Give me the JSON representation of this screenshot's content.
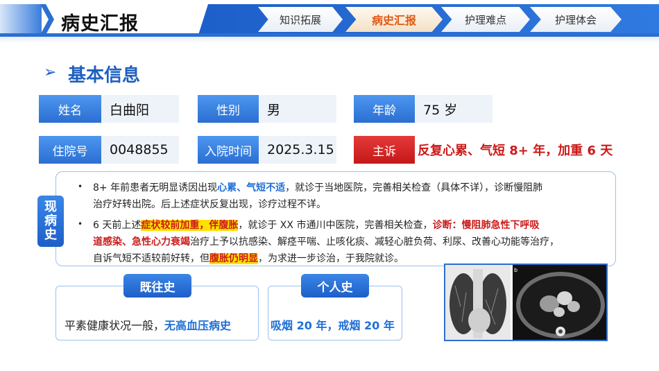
{
  "header": {
    "title": "病史汇报",
    "tabs": [
      {
        "label": "知识拓展",
        "active": false
      },
      {
        "label": "病史汇报",
        "active": true
      },
      {
        "label": "护理难点",
        "active": false
      },
      {
        "label": "护理体会",
        "active": false
      }
    ]
  },
  "section": {
    "title": "基本信息"
  },
  "info": {
    "name_label": "姓名",
    "name": "白曲阳",
    "gender_label": "性别",
    "gender": "男",
    "age_label": "年龄",
    "age": "75 岁",
    "id_label": "住院号",
    "id": "0048855",
    "admit_label": "入院时间",
    "admit": "2025.3.15",
    "complaint_label": "主诉",
    "complaint": "反复心累、气短 8+ 年，加重 6 天"
  },
  "present_history": {
    "tag": [
      "现",
      "病",
      "史"
    ],
    "p1": {
      "a": "8+ 年前患者无明显诱因出现",
      "b": "心累、气短不适",
      "c": "，就诊于当地医院，完善相关检查（具体不详），诊断慢阻肺",
      "d": "治疗好转出院。后上述症状反复出现，诊疗过程不详。"
    },
    "p2": {
      "a": "6 天前上述",
      "b": "症状较前加重，伴腹胀",
      "c": "，就诊于 XX 市通川中医院，完善相关检查，",
      "d": "诊断：慢阻肺急性下呼吸",
      "e": "道感染、急性心力衰竭",
      "f": "治疗上予以抗感染、解痉平喘、止咳化痰、减轻心脏负荷、利尿、改善心功能等治疗，",
      "g": "自诉气短不适较前好转，但",
      "h": "腹胀仍明显",
      "i": "，为求进一步诊治，于我院就诊。"
    }
  },
  "past_history": {
    "tag": "既往史",
    "text_a": "平素健康状况一般，",
    "text_b": "无高血压病史"
  },
  "personal_history": {
    "tag": "个人史",
    "text": "吸烟 20 年，戒烟 20 年"
  },
  "colors": {
    "primary": "#2b6fd2",
    "accent_red": "#cc1a1a",
    "active_tab": "#e05a16",
    "highlight": "#ffe100"
  },
  "icons": {
    "section_arrow": "chevron-right-icon"
  }
}
